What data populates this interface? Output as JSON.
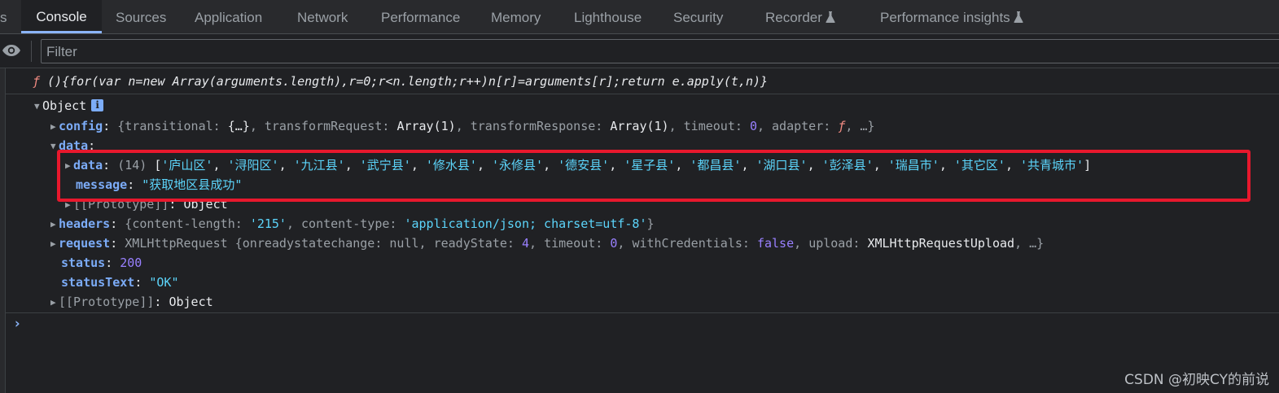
{
  "tabs": {
    "partial": "s",
    "console": "Console",
    "sources": "Sources",
    "application": "Application",
    "network": "Network",
    "performance": "Performance",
    "memory": "Memory",
    "lighthouse": "Lighthouse",
    "security": "Security",
    "recorder": "Recorder",
    "performance_insights": "Performance insights"
  },
  "filter": {
    "placeholder": "Filter"
  },
  "console": {
    "fn_prefix": "ƒ",
    "fn_text": "(){for(var n=new Array(arguments.length),r=0;r<n.length;r++)n[r]=arguments[r];return e.apply(t,n)}",
    "object_label": "Object",
    "info": "i",
    "config": {
      "key": "config",
      "t1": "{",
      "transitional_key": "transitional",
      "transitional_val": "{…}",
      "transformRequest_key": "transformRequest",
      "transformRequest_val": "Array(1)",
      "transformResponse_key": "transformResponse",
      "transformResponse_val": "Array(1)",
      "timeout_key": "timeout",
      "timeout_val": "0",
      "adapter_key": "adapter",
      "adapter_val": "ƒ",
      "tail": ", …}"
    },
    "data_key": "data",
    "inner_data": {
      "key": "data",
      "count": "(14)",
      "items": [
        "'庐山区'",
        "'浔阳区'",
        "'九江县'",
        "'武宁县'",
        "'修水县'",
        "'永修县'",
        "'德安县'",
        "'星子县'",
        "'都昌县'",
        "'湖口县'",
        "'彭泽县'",
        "'瑞昌市'",
        "'其它区'",
        "'共青城市'"
      ]
    },
    "message": {
      "key": "message",
      "value": "\"获取地区县成功\""
    },
    "proto_inner": {
      "key": "[[Prototype]]",
      "value": "Object"
    },
    "headers": {
      "key": "headers",
      "cl_key": "content-length",
      "cl_val": "'215'",
      "ct_key": "content-type",
      "ct_val": "'application/json; charset=utf-8'"
    },
    "request": {
      "key": "request",
      "type": "XMLHttpRequest",
      "orsc_key": "onreadystatechange",
      "orsc_val": "null",
      "rs_key": "readyState",
      "rs_val": "4",
      "to_key": "timeout",
      "to_val": "0",
      "wc_key": "withCredentials",
      "wc_val": "false",
      "up_key": "upload",
      "up_val": "XMLHttpRequestUpload",
      "tail": ", …}"
    },
    "status": {
      "key": "status",
      "value": "200"
    },
    "statusText": {
      "key": "statusText",
      "value": "\"OK\""
    },
    "proto_outer": {
      "key": "[[Prototype]]",
      "value": "Object"
    },
    "prompt": "›"
  },
  "watermark": "CSDN @初映CY的前说",
  "colors": {
    "highlight_box": "#e8182d",
    "key_blue": "#7cacf8",
    "string_cyan": "#5cd5fb",
    "number_purple": "#9980ff"
  }
}
